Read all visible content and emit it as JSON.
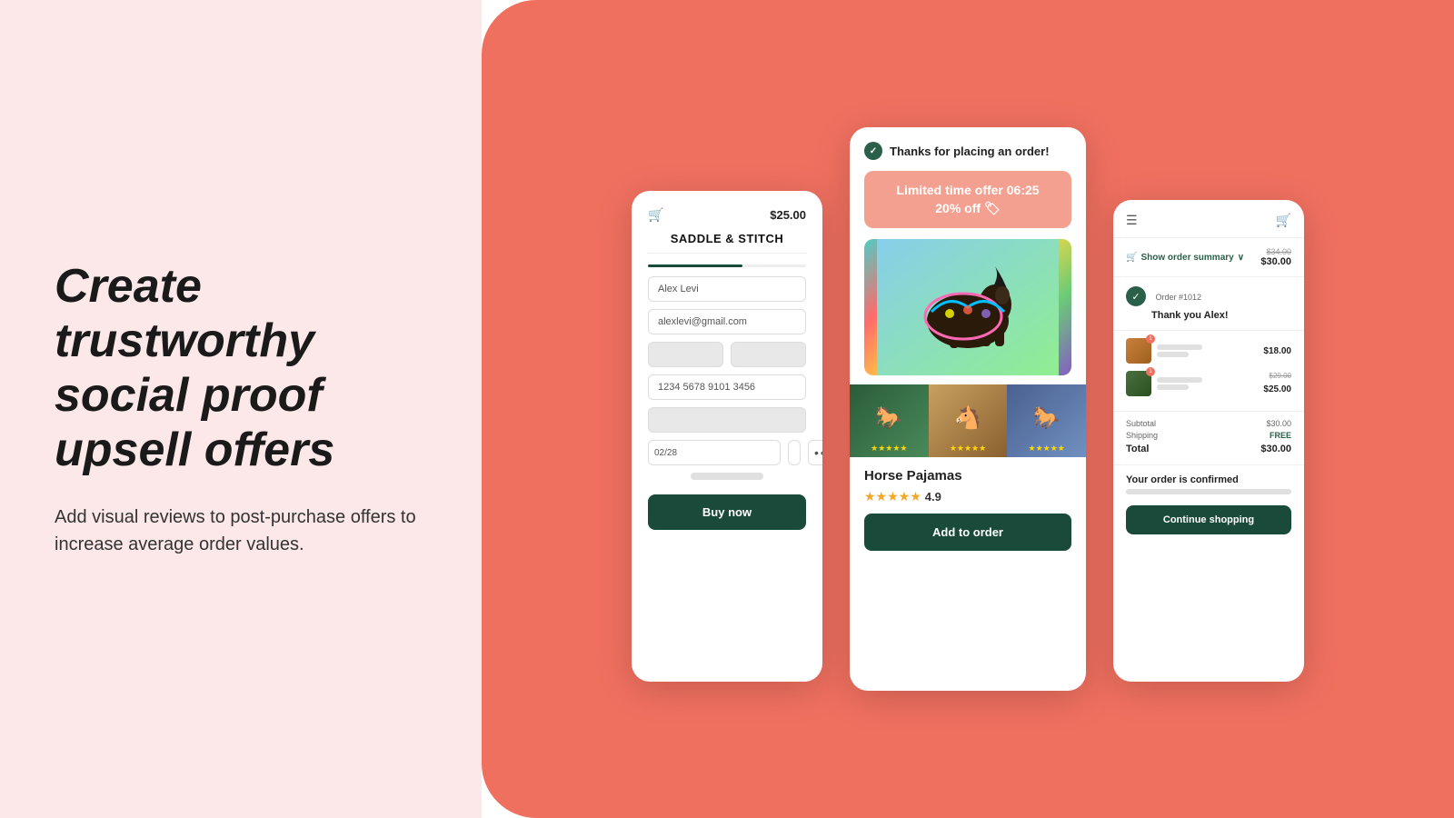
{
  "left": {
    "title": "Create trustworthy social proof upsell offers",
    "subtitle": "Add visual reviews to post-purchase offers to increase average order values."
  },
  "phone1": {
    "store_name": "SADDLE & STITCH",
    "price": "$25.00",
    "fields": {
      "name": "Alex Levi",
      "email": "alexlevi@gmail.com",
      "card_number": "1234 5678 9101 3456",
      "expiry": "02/28",
      "dots": "•••"
    },
    "buy_button": "Buy now"
  },
  "phone2": {
    "thanks_header": "Thanks for placing an order!",
    "offer_label": "Limited time offer 06:25",
    "offer_discount": "20% off 🏷",
    "product_name": "Horse Pajamas",
    "rating": "4.9",
    "stars": "★★★★★",
    "add_button": "Add to order"
  },
  "phone3": {
    "order_summary_label": "Show order summary",
    "price_original": "$34.00",
    "price_current": "$30.00",
    "order_number": "Order #1012",
    "thank_you": "Thank you Alex!",
    "items": [
      {
        "price": "$18.00"
      },
      {
        "price_original": "$29.00",
        "price": "$25.00"
      }
    ],
    "subtotal_label": "Subtotal",
    "subtotal_value": "$30.00",
    "shipping_label": "Shipping",
    "shipping_value": "FREE",
    "total_label": "Total",
    "total_value": "$30.00",
    "confirmed_title": "Your order is confirmed",
    "continue_button": "Continue shopping"
  }
}
